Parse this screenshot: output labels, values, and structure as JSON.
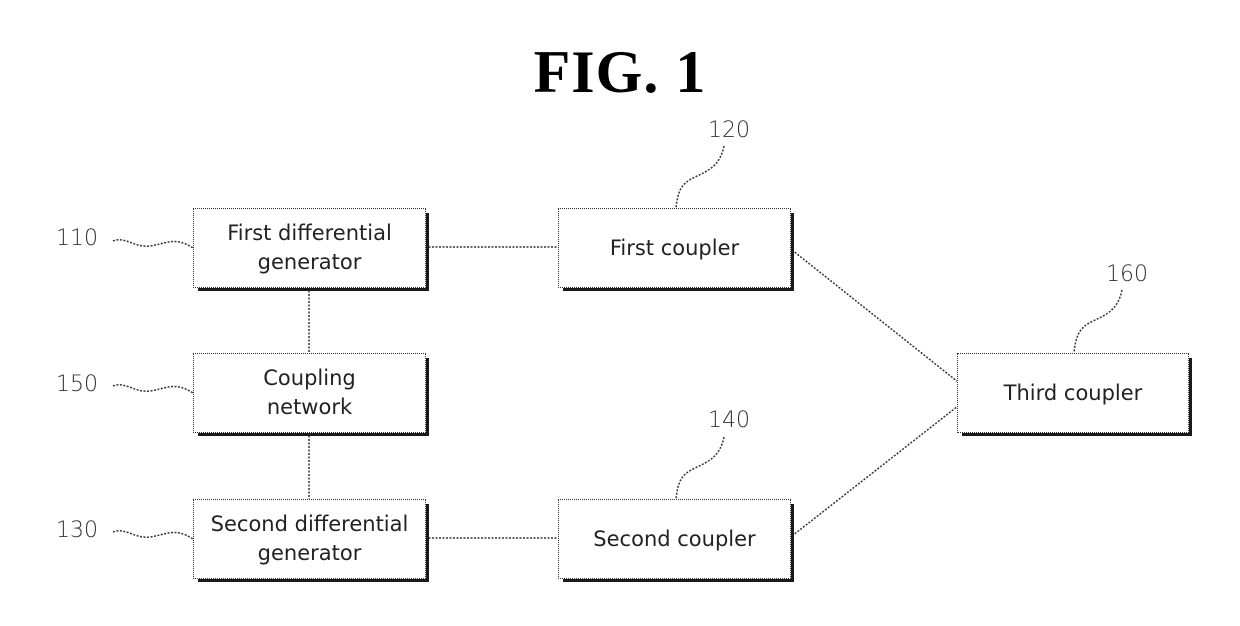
{
  "figure": {
    "title": "FIG. 1"
  },
  "blocks": [
    {
      "id": "110",
      "ref": "110",
      "label_line1": "First differential",
      "label_line2": "generator"
    },
    {
      "id": "120",
      "ref": "120",
      "label_line1": "First coupler",
      "label_line2": ""
    },
    {
      "id": "150",
      "ref": "150",
      "label_line1": "Coupling",
      "label_line2": "network"
    },
    {
      "id": "130",
      "ref": "130",
      "label_line1": "Second differential",
      "label_line2": "generator"
    },
    {
      "id": "140",
      "ref": "140",
      "label_line1": "Second coupler",
      "label_line2": ""
    },
    {
      "id": "160",
      "ref": "160",
      "label_line1": "Third coupler",
      "label_line2": ""
    }
  ],
  "connections": [
    {
      "from": "110",
      "to": "120"
    },
    {
      "from": "110",
      "to": "150"
    },
    {
      "from": "150",
      "to": "130"
    },
    {
      "from": "130",
      "to": "140"
    },
    {
      "from": "120",
      "to": "160"
    },
    {
      "from": "140",
      "to": "160"
    }
  ]
}
